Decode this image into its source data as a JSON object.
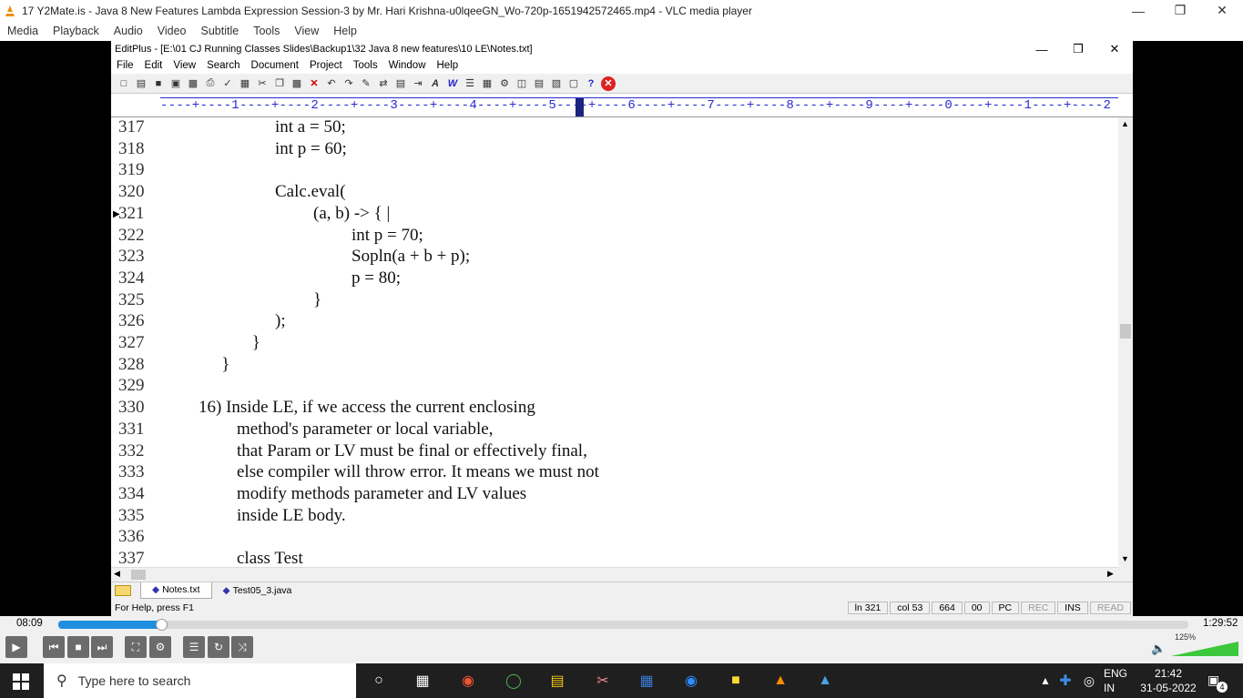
{
  "vlc": {
    "title": "17 Y2Mate.is - Java 8 New Features  Lambda Expression  Session-3  by Mr. Hari Krishna-u0lqeeGN_Wo-720p-1651942572465.mp4 - VLC media player",
    "menu": [
      "Media",
      "Playback",
      "Audio",
      "Video",
      "Subtitle",
      "Tools",
      "View",
      "Help"
    ],
    "elapsed": "08:09",
    "total": "1:29:52",
    "progress": 0.091,
    "volume_label": "125%",
    "volume": 1.0
  },
  "editplus": {
    "title": "EditPlus - [E:\\01 CJ Running Classes Slides\\Backup1\\32 Java 8 new features\\10 LE\\Notes.txt]",
    "menu": [
      "File",
      "Edit",
      "View",
      "Search",
      "Document",
      "Project",
      "Tools",
      "Window",
      "Help"
    ],
    "ruler": "----+----1----+----2----+----3----+----4----+----5----+----6----+----7----+----8----+----9----+----0----+----1----+----2",
    "lines": [
      {
        "n": "317",
        "text": "int a = 50;",
        "indent": 2
      },
      {
        "n": "318",
        "text": "int p = 60;",
        "indent": 2
      },
      {
        "n": "319",
        "text": "",
        "indent": 0
      },
      {
        "n": "320",
        "text": "Calc.eval(",
        "indent": 2
      },
      {
        "n": "321",
        "text": "(a, b) -> { |",
        "indent": 3,
        "current": true
      },
      {
        "n": "322",
        "text": "int p = 70;",
        "indent": 4
      },
      {
        "n": "323",
        "text": "Sopln(a + b + p);",
        "indent": 4
      },
      {
        "n": "324",
        "text": "p = 80;",
        "indent": 4
      },
      {
        "n": "325",
        "text": "}",
        "indent": 3
      },
      {
        "n": "326",
        "text": ");",
        "indent": 2
      },
      {
        "n": "327",
        "text": "}",
        "indent": 1.4
      },
      {
        "n": "328",
        "text": "}",
        "indent": 0.6
      },
      {
        "n": "329",
        "text": "",
        "indent": 0
      },
      {
        "n": "330",
        "text": "16) Inside LE, if we access the current enclosing",
        "indent": 0
      },
      {
        "n": "331",
        "text": "method's parameter or local variable,",
        "indent": 1
      },
      {
        "n": "332",
        "text": "that Param or LV must be final or effectively final,",
        "indent": 1
      },
      {
        "n": "333",
        "text": "else compiler will throw error. It means we must not",
        "indent": 1
      },
      {
        "n": "334",
        "text": "modify methods parameter and LV values",
        "indent": 1
      },
      {
        "n": "335",
        "text": "inside LE body.",
        "indent": 1
      },
      {
        "n": "336",
        "text": "",
        "indent": 0
      },
      {
        "n": "337",
        "text": "class Test",
        "indent": 1
      }
    ],
    "tabs": [
      "Notes.txt",
      "Test05_3.java"
    ],
    "status": {
      "help": "For Help, press F1",
      "ln": "ln 321",
      "col": "col 53",
      "chars": "664",
      "code": "00",
      "mode": "PC",
      "rec": "REC",
      "ins": "INS",
      "read": "READ"
    }
  },
  "taskbar": {
    "search_placeholder": "Type here to search",
    "lang_top": "ENG",
    "lang_bottom": "IN",
    "time": "21:42",
    "date": "31-05-2022",
    "notifications": "4"
  }
}
